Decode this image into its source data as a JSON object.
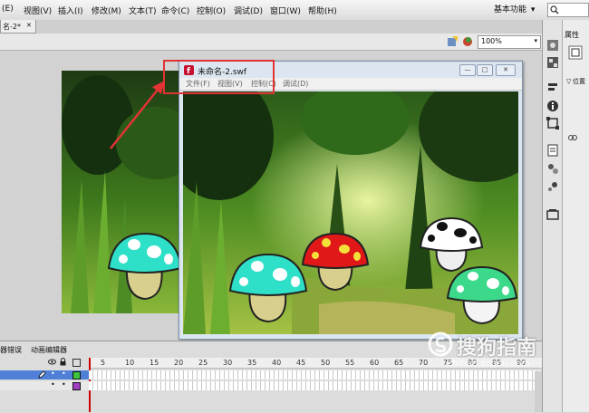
{
  "menubar": {
    "items": [
      "(E)",
      "视图(V)",
      "插入(I)",
      "修改(M)",
      "文本(T)",
      "命令(C)",
      "控制(O)",
      "调试(D)",
      "窗口(W)",
      "帮助(H)"
    ],
    "workspace": "基本功能",
    "workspace_arrow": "▾"
  },
  "document_tab": {
    "label": "名-2*",
    "close": "✕"
  },
  "editbar": {
    "zoom": "100%"
  },
  "swf_window": {
    "title": "未命名-2.swf",
    "menus": [
      "文件(F)",
      "视图(V)",
      "控制(C)",
      "调试(D)"
    ],
    "minimize": "—",
    "maximize": "□",
    "close": "✕"
  },
  "right_panel": {
    "title": "属性",
    "subtitle": "位置"
  },
  "timeline": {
    "tabs": [
      "器错误",
      "动画编辑器"
    ],
    "frame_numbers": [
      "5",
      "10",
      "15",
      "20",
      "25",
      "30",
      "35",
      "40",
      "45",
      "50",
      "55",
      "60",
      "65",
      "70",
      "75",
      "80",
      "85",
      "90"
    ]
  },
  "watermark": {
    "text": "搜狗指南",
    "url": "zhinan.sogou.com"
  },
  "colors": {
    "annotation_red": "#e03434",
    "forest_dark": "#1f4a16",
    "forest_light": "#7fb43c",
    "mushroom_cyan": "#2fe0c8",
    "mushroom_red": "#e01818",
    "mushroom_green": "#3cd98a"
  },
  "icons": {
    "flash_logo": "flash-logo-icon",
    "search": "search-icon",
    "pencil": "pencil-icon",
    "eye": "eye-icon",
    "lock": "lock-icon"
  }
}
